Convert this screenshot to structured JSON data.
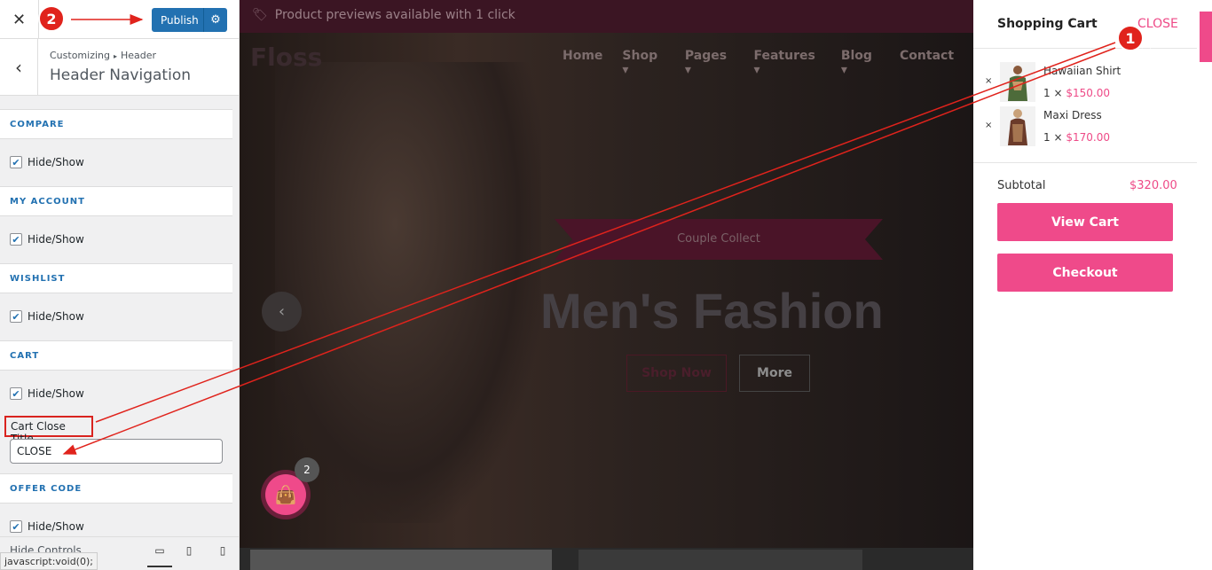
{
  "sidebar": {
    "close_icon": "close-icon",
    "publish_label": "Publish",
    "breadcrumb_root": "Customizing",
    "breadcrumb_sep": "▸",
    "breadcrumb_leaf": "Header",
    "section_title": "Header Navigation",
    "sections": [
      {
        "label": "COMPARE",
        "toggle": "Hide/Show"
      },
      {
        "label": "MY ACCOUNT",
        "toggle": "Hide/Show"
      },
      {
        "label": "WISHLIST",
        "toggle": "Hide/Show"
      },
      {
        "label": "CART",
        "toggle": "Hide/Show"
      },
      {
        "label": "OFFER CODE",
        "toggle": "Hide/Show"
      }
    ],
    "cart_close_title_label": "Cart Close Title",
    "cart_close_title_value": "CLOSE",
    "hide_controls": "Hide Controls",
    "status_text": "javascript:void(0);"
  },
  "preview": {
    "announcement": "Product previews available with 1 click",
    "logo_text": "Floss",
    "nav": [
      "Home",
      "Shop ▾",
      "Pages ▾",
      "Features ▾",
      "Blog ▾",
      "Contact"
    ],
    "ribbon_label": "Couple Collect",
    "headline": "Men's Fashion",
    "btn_shop": "Shop Now",
    "btn_more": "More",
    "cart_count": "2"
  },
  "cart": {
    "title": "Shopping Cart",
    "close_label": "CLOSE",
    "items": [
      {
        "name": "Hawaiian Shirt",
        "qty": "1 ×",
        "price": "$150.00"
      },
      {
        "name": "Maxi Dress",
        "qty": "1 ×",
        "price": "$170.00"
      }
    ],
    "subtotal_label": "Subtotal",
    "subtotal_value": "$320.00",
    "view_cart": "View Cart",
    "checkout": "Checkout"
  },
  "annotations": {
    "step1": "1",
    "step2": "2"
  },
  "colors": {
    "accent": "#ef4a8a",
    "wp_blue": "#2271b1",
    "annotation_red": "#e0231c"
  }
}
